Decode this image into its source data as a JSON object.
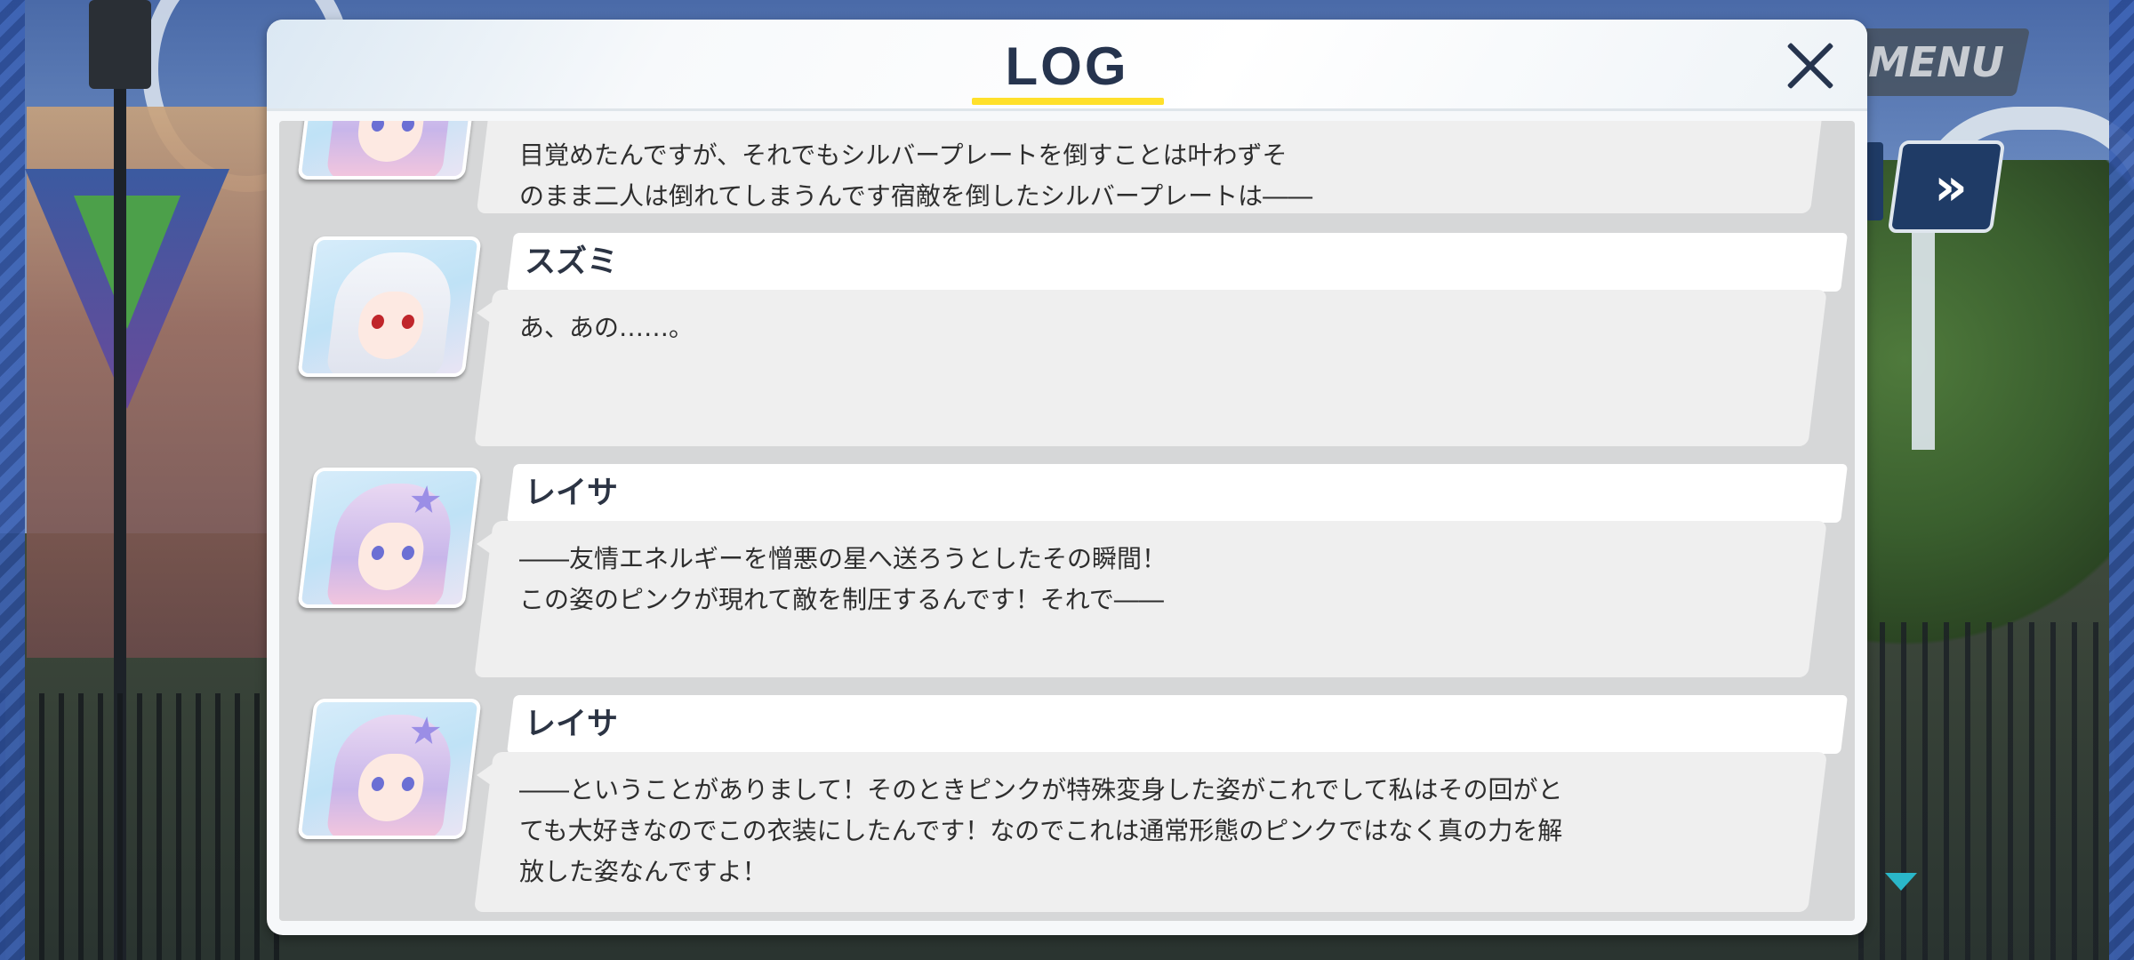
{
  "hud": {
    "menu_label": "MENU",
    "fast_forward_icon": "double-chevron-right",
    "scroll_down_icon": "triangle-down"
  },
  "log": {
    "title": "LOG",
    "close_icon": "close-x",
    "entries": [
      {
        "speaker": "",
        "avatar": "reisa",
        "lines": [
          "目覚めたんですが、それでもシルバープレートを倒すことは叶わずそ",
          "のまま二人は倒れてしまうんです宿敵を倒したシルバープレートは――"
        ]
      },
      {
        "speaker": "スズミ",
        "avatar": "suzumi",
        "lines": [
          "あ、あの……。"
        ]
      },
      {
        "speaker": "レイサ",
        "avatar": "reisa",
        "lines": [
          "――友情エネルギーを憎悪の星へ送ろうとしたその瞬間！",
          "この姿のピンクが現れて敵を制圧するんです！それで――"
        ]
      },
      {
        "speaker": "レイサ",
        "avatar": "reisa",
        "lines": [
          "――ということがありまして！そのときピンクが特殊変身した姿がこれでして私はその回がと",
          "ても大好きなのでこの衣装にしたんです！なのでこれは通常形態のピンクではなく真の力を解",
          "放した姿なんですよ！"
        ]
      }
    ]
  },
  "colors": {
    "title": "#26344e",
    "underline": "#ffe02b",
    "scroll_arrow": "#2ab7c9"
  }
}
